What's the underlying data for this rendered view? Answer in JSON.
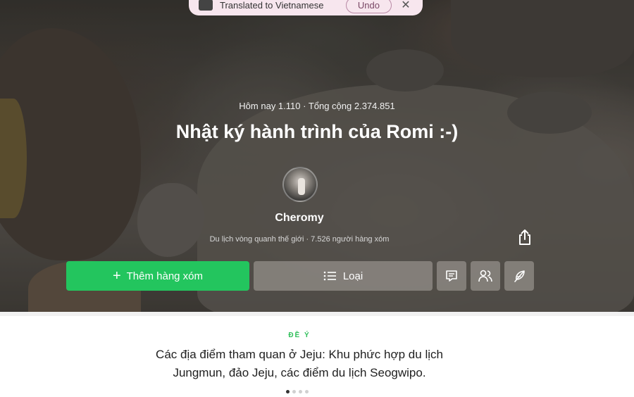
{
  "toast": {
    "text": "Translated to Vietnamese",
    "undo_label": "Undo",
    "icons": {
      "translate": "translate-icon",
      "close": "close-icon"
    }
  },
  "hero": {
    "stats": "Hôm nay 1.110 · Tổng cộng 2.374.851",
    "title": "Nhật ký hành trình của Romi :-)",
    "author_name": "Cheromy",
    "author_sub": "Du lịch vòng quanh thế giới · 7.526 người hàng xóm",
    "share_icon": "share-icon"
  },
  "actions": {
    "add_neighbor_label": "Thêm hàng xóm",
    "category_label": "Loại",
    "icons": [
      "comment-icon",
      "people-icon",
      "feather-icon"
    ]
  },
  "suggestion": {
    "label": "ĐỀ Ý",
    "text": "Các địa điểm tham quan ở Jeju: Khu phức hợp du lịch Jungmun, đảo Jeju, các điểm du lịch Seogwipo.",
    "page_count": 4,
    "active_page": 1
  },
  "colors": {
    "accent_green": "#23c55e",
    "label_green": "#2fbf5a",
    "toast_bg": "#f7e6ee"
  }
}
